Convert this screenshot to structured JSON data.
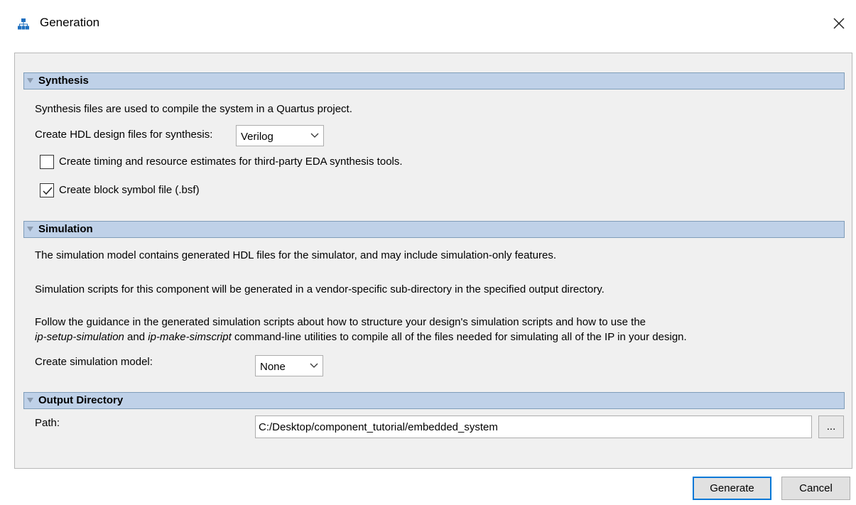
{
  "window": {
    "title": "Generation",
    "app_icon": "hierarchy-icon",
    "close_icon": "close-icon",
    "close_glyph": "✕"
  },
  "synthesis": {
    "header": "Synthesis",
    "description": "Synthesis files are used to compile the system in a Quartus project.",
    "hdl_label": "Create HDL design files for synthesis:",
    "hdl_value": "Verilog",
    "timing_checkbox": {
      "label": "Create timing and resource estimates for third-party EDA synthesis tools.",
      "checked": false
    },
    "bsf_checkbox": {
      "label": "Create block symbol file (.bsf)",
      "checked": true
    }
  },
  "simulation": {
    "header": "Simulation",
    "para1": "The simulation model contains generated HDL files for the simulator, and may include simulation-only features.",
    "para2": "Simulation scripts for this component will be generated in a vendor-specific sub-directory in the specified output directory.",
    "para3_line1": "Follow the guidance in the generated simulation scripts about how to structure your design's simulation scripts and how to use the",
    "para3_line2_italic1": "ip-setup-simulation",
    "para3_line2_and": " and ",
    "para3_line2_italic2": "ip-make-simscript",
    "para3_line2_rest": " command-line utilities to compile all of the files needed for simulating all of the IP in your design.",
    "model_label": "Create simulation model:",
    "model_value": "None"
  },
  "output": {
    "header": "Output Directory",
    "path_label": "Path:",
    "path_value": "C:/Desktop/component_tutorial/embedded_system",
    "browse_label": "..."
  },
  "footer": {
    "generate_label": "Generate",
    "cancel_label": "Cancel"
  },
  "colors": {
    "section_header_bg": "#bfd1e8",
    "section_header_border": "#7f9db9",
    "primary_button_border": "#0078d7"
  }
}
